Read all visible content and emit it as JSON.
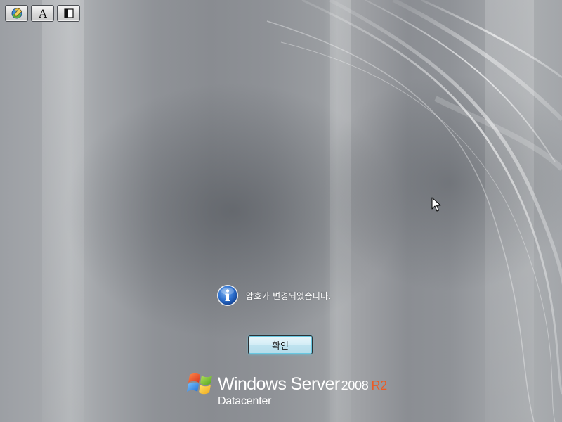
{
  "toolbar": {
    "buttons": [
      {
        "icon": "ease-of-access-icon"
      },
      {
        "icon": "font-size-icon",
        "glyph": "A"
      },
      {
        "icon": "high-contrast-icon"
      }
    ]
  },
  "dialog": {
    "icon": "info-icon",
    "message": "암호가 변경되었습니다.",
    "ok_label": "확인"
  },
  "branding": {
    "product": "Windows Server",
    "version": "2008",
    "release": "R2",
    "edition": "Datacenter",
    "release_color": "#ec5b24"
  },
  "colors": {
    "button_glow": "#68c8e2",
    "info_blue": "#1f5fbf"
  }
}
